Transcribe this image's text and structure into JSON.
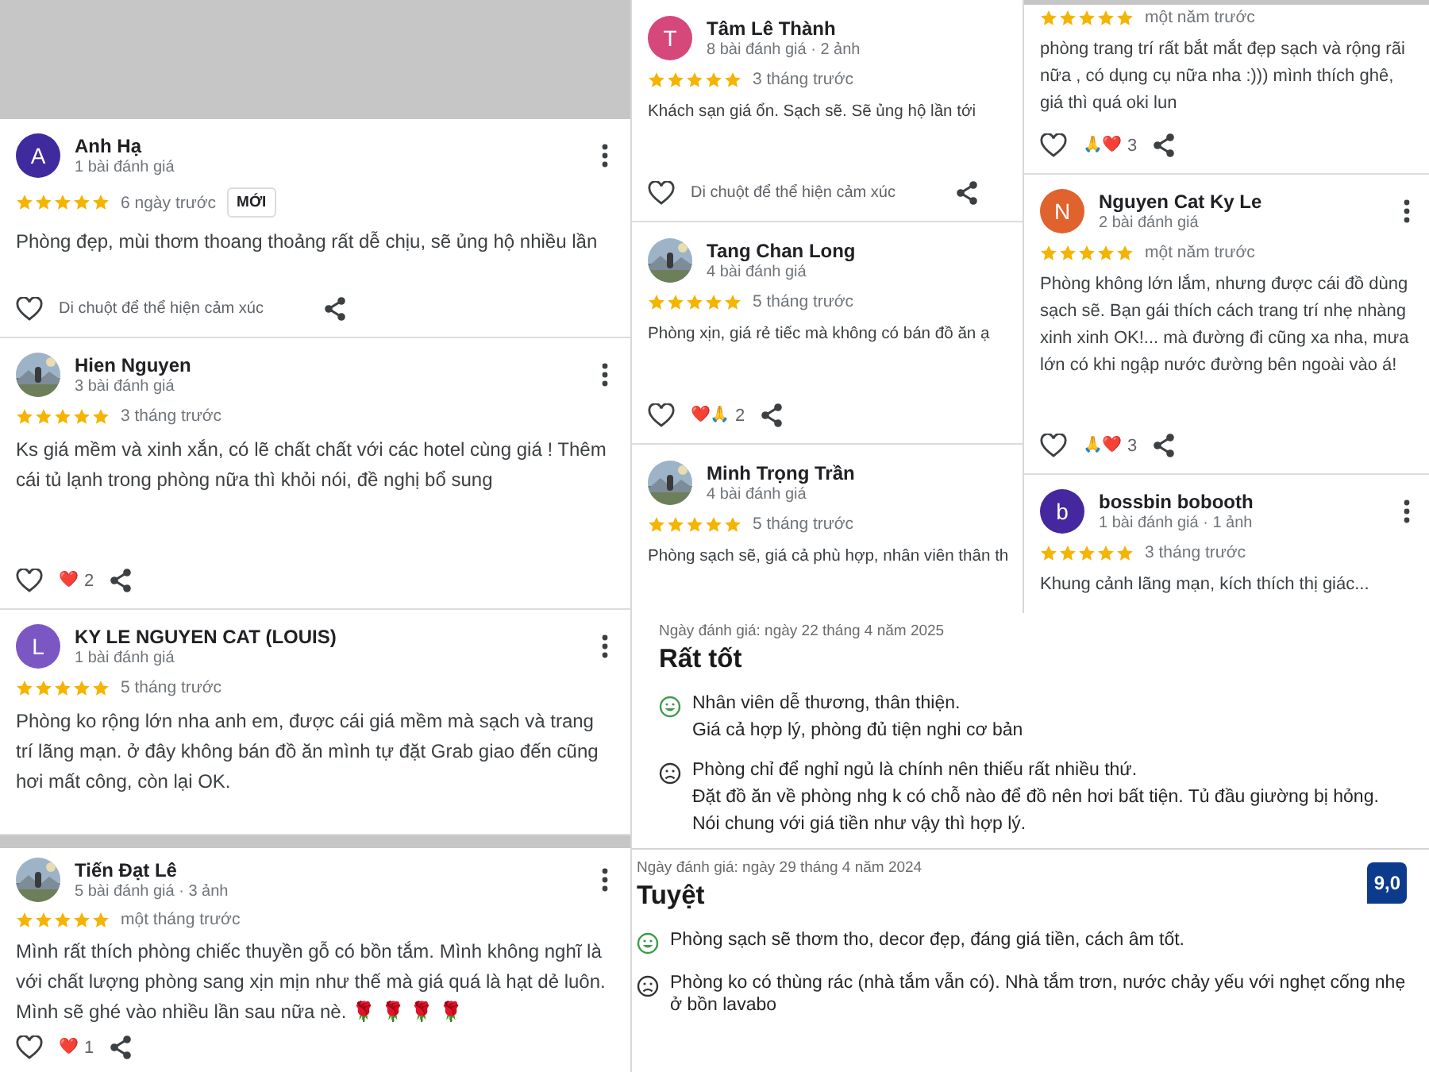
{
  "left_reviews": [
    {
      "avatar": {
        "kind": "letter",
        "letter": "A",
        "color": "#3f2a9e"
      },
      "name": "Anh Hạ",
      "meta": "1 bài đánh giá",
      "menu": true,
      "stars": 5,
      "time": "6 ngày trước",
      "badge": "MỚI",
      "text": "Phòng đẹp, mùi thơm thoang thoảng rất dễ chịu, sẽ ủng hộ nhiều lần",
      "reactions": {
        "kind": "hint",
        "hint": "Di chuột để thể hiện cảm xúc"
      }
    },
    {
      "name": "Hien Nguyen",
      "meta": "3 bài đánh giá",
      "menu": true,
      "stars": 5,
      "time": "3 tháng trước",
      "text": "Ks giá mềm và xinh xắn, có lẽ chất chất với các hotel cùng giá ! Thêm cái tủ lạnh trong phòng nữa thì khỏi nói, đề nghị bổ sung",
      "reactions": {
        "kind": "count",
        "emoji": "❤️",
        "count": "2"
      }
    },
    {
      "avatar": {
        "kind": "letter",
        "letter": "L",
        "color": "#7b57c4"
      },
      "name": "KY LE NGUYEN CAT (LOUIS)",
      "meta": "1 bài đánh giá",
      "menu": true,
      "stars": 5,
      "time": "5 tháng trước",
      "text": "Phòng ko rộng lớn nha anh em, được cái giá mềm mà sạch và trang trí lãng mạn. ở đây không bán đồ ăn mình tự đặt Grab giao đến cũng hơi mất công, còn lại OK."
    },
    {
      "name": "Tiến Đạt Lê",
      "meta": "5 bài đánh giá · 3 ảnh",
      "menu": true,
      "stars": 5,
      "time": "một tháng trước",
      "text": "Mình rất thích phòng chiếc thuyền gỗ có bồn tắm. Mình không nghĩ là với chất lượng phòng sang xịn mịn như thế mà giá quá là hạt dẻ luôn. Mình sẽ ghé vào nhiều lần sau nữa nè. 🌹 🌹 🌹 🌹",
      "reactions": {
        "kind": "count",
        "emoji": "❤️",
        "count": "1"
      }
    }
  ],
  "middle_reviews": [
    {
      "avatar": {
        "kind": "letter",
        "letter": "T",
        "color": "#d6477a"
      },
      "name": "Tâm Lê Thành",
      "meta": "8 bài đánh giá · 2 ảnh",
      "menu": false,
      "stars": 5,
      "time": "3 tháng trước",
      "text": "Khách sạn giá ổn. Sạch sẽ. Sẽ ủng hộ lần tới",
      "reactions": {
        "kind": "hint",
        "hint": "Di chuột để thể hiện cảm xúc"
      }
    },
    {
      "name": "Tang Chan Long",
      "meta": "4 bài đánh giá",
      "menu": false,
      "stars": 5,
      "time": "5 tháng trước",
      "text": "Phòng xịn, giá rẻ tiếc mà không có bán đồ ăn ạ",
      "reactions": {
        "kind": "count",
        "emoji": "❤️🙏",
        "count": "2"
      }
    },
    {
      "name": "Minh Trọng Trần",
      "meta": "4 bài đánh giá",
      "menu": false,
      "stars": 5,
      "time": "5 tháng trước",
      "text": "Phòng sạch sẽ, giá cả phù hợp, nhân viên thân th"
    }
  ],
  "right_reviews": [
    {
      "stars": 5,
      "time": "một năm trước",
      "text": "phòng trang trí rất bắt mắt đẹp sạch và rộng rãi nữa , có dụng cụ nữa nha :))) mình thích ghê, giá thì quá oki lun",
      "reactions": {
        "kind": "count",
        "emoji": "🙏❤️",
        "count": "3"
      }
    },
    {
      "avatar": {
        "kind": "letter",
        "letter": "N",
        "color": "#e0622d"
      },
      "name": "Nguyen Cat Ky Le",
      "meta": "2 bài đánh giá",
      "menu": true,
      "stars": 5,
      "time": "một năm trước",
      "text": "Phòng không lớn lắm, nhưng được cái đồ dùng sạch sẽ. Bạn gái thích cách trang trí nhẹ nhàng xinh xinh OK!... mà đường đi cũng xa nha, mưa lớn có khi ngập nước đường bên ngoài vào á!",
      "reactions": {
        "kind": "count",
        "emoji": "🙏❤️",
        "count": "3"
      }
    },
    {
      "avatar": {
        "kind": "letter",
        "letter": "b",
        "color": "#4527a0"
      },
      "name": "bossbin bobooth",
      "meta": "1 bài đánh giá · 1 ảnh",
      "menu": true,
      "stars": 5,
      "time": "3 tháng trước",
      "text": "Khung cảnh lãng mạn, kích thích thị giác..."
    }
  ],
  "booking_reviews": [
    {
      "date": "Ngày đánh giá: ngày 22 tháng 4 năm 2025",
      "title": "Rất tốt",
      "points": [
        {
          "kind": "positive",
          "lines": [
            "Nhân viên dễ thương, thân thiện.",
            "Giá cả hợp lý, phòng đủ tiện nghi cơ bản"
          ]
        },
        {
          "kind": "negative",
          "lines": [
            "Phòng chỉ để nghỉ ngủ là chính nên thiếu rất nhiều thứ.",
            "Đặt đồ ăn về phòng nhg k có chỗ nào để đồ nên hơi bất tiện. Tủ đầu giường bị hỏng.",
            "Nói chung với giá tiền như vậy thì hợp lý."
          ]
        }
      ]
    },
    {
      "date": "Ngày đánh giá: ngày 29 tháng 4 năm 2024",
      "title": "Tuyệt",
      "score": "9,0",
      "points": [
        {
          "kind": "positive",
          "lines": [
            "Phòng sạch sẽ thơm tho, decor đẹp, đáng giá tiền, cách âm tốt."
          ]
        },
        {
          "kind": "negative",
          "lines": [
            "Phòng ko có thùng rác (nhà tắm vẫn có). Nhà tắm trơn, nước chảy yếu với nghẹt cống nhẹ ở bồn lavabo"
          ]
        }
      ]
    }
  ]
}
